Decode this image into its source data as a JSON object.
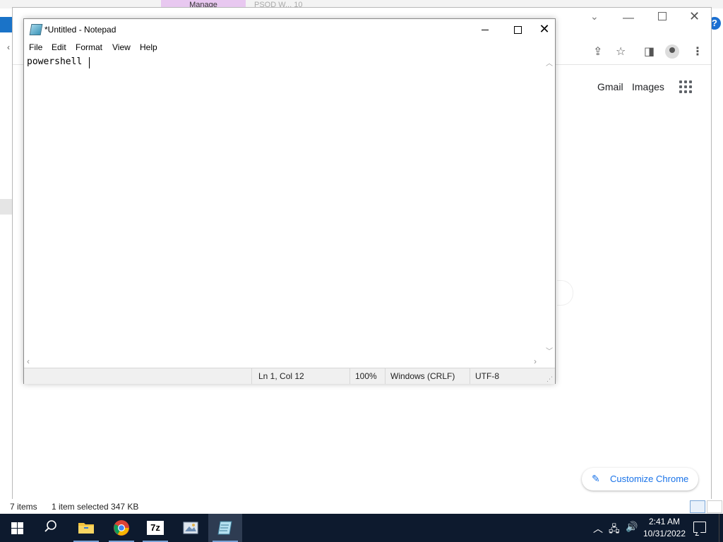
{
  "explorer": {
    "manage_tab": "Manage",
    "other_tab": "PSOD W... 10",
    "status_items": "7 items",
    "status_selected": "1 item selected  347 KB",
    "help_label": "?"
  },
  "chrome": {
    "header_links": {
      "gmail": "Gmail",
      "images": "Images"
    },
    "customize_label": "Customize Chrome",
    "icons": [
      "share-icon",
      "star-icon",
      "side-panel-icon",
      "profile-avatar",
      "more-menu-icon",
      "apps-icon"
    ]
  },
  "notepad": {
    "title": "*Untitled - Notepad",
    "menu": [
      "File",
      "Edit",
      "Format",
      "View",
      "Help"
    ],
    "content": "powershell ",
    "status": {
      "position": "Ln 1, Col 12",
      "zoom": "100%",
      "line_ending": "Windows (CRLF)",
      "encoding": "UTF-8"
    }
  },
  "taskbar": {
    "apps": [
      "file-explorer",
      "chrome",
      "7-zip",
      "paint",
      "notepad"
    ],
    "app_7zip_label": "7z",
    "time": "2:41 AM",
    "date": "10/31/2022"
  },
  "colors": {
    "taskbar_bg": "#0d1a2e",
    "chrome_accent": "#1a73e8",
    "manage_tab": "#e8c8f0"
  }
}
